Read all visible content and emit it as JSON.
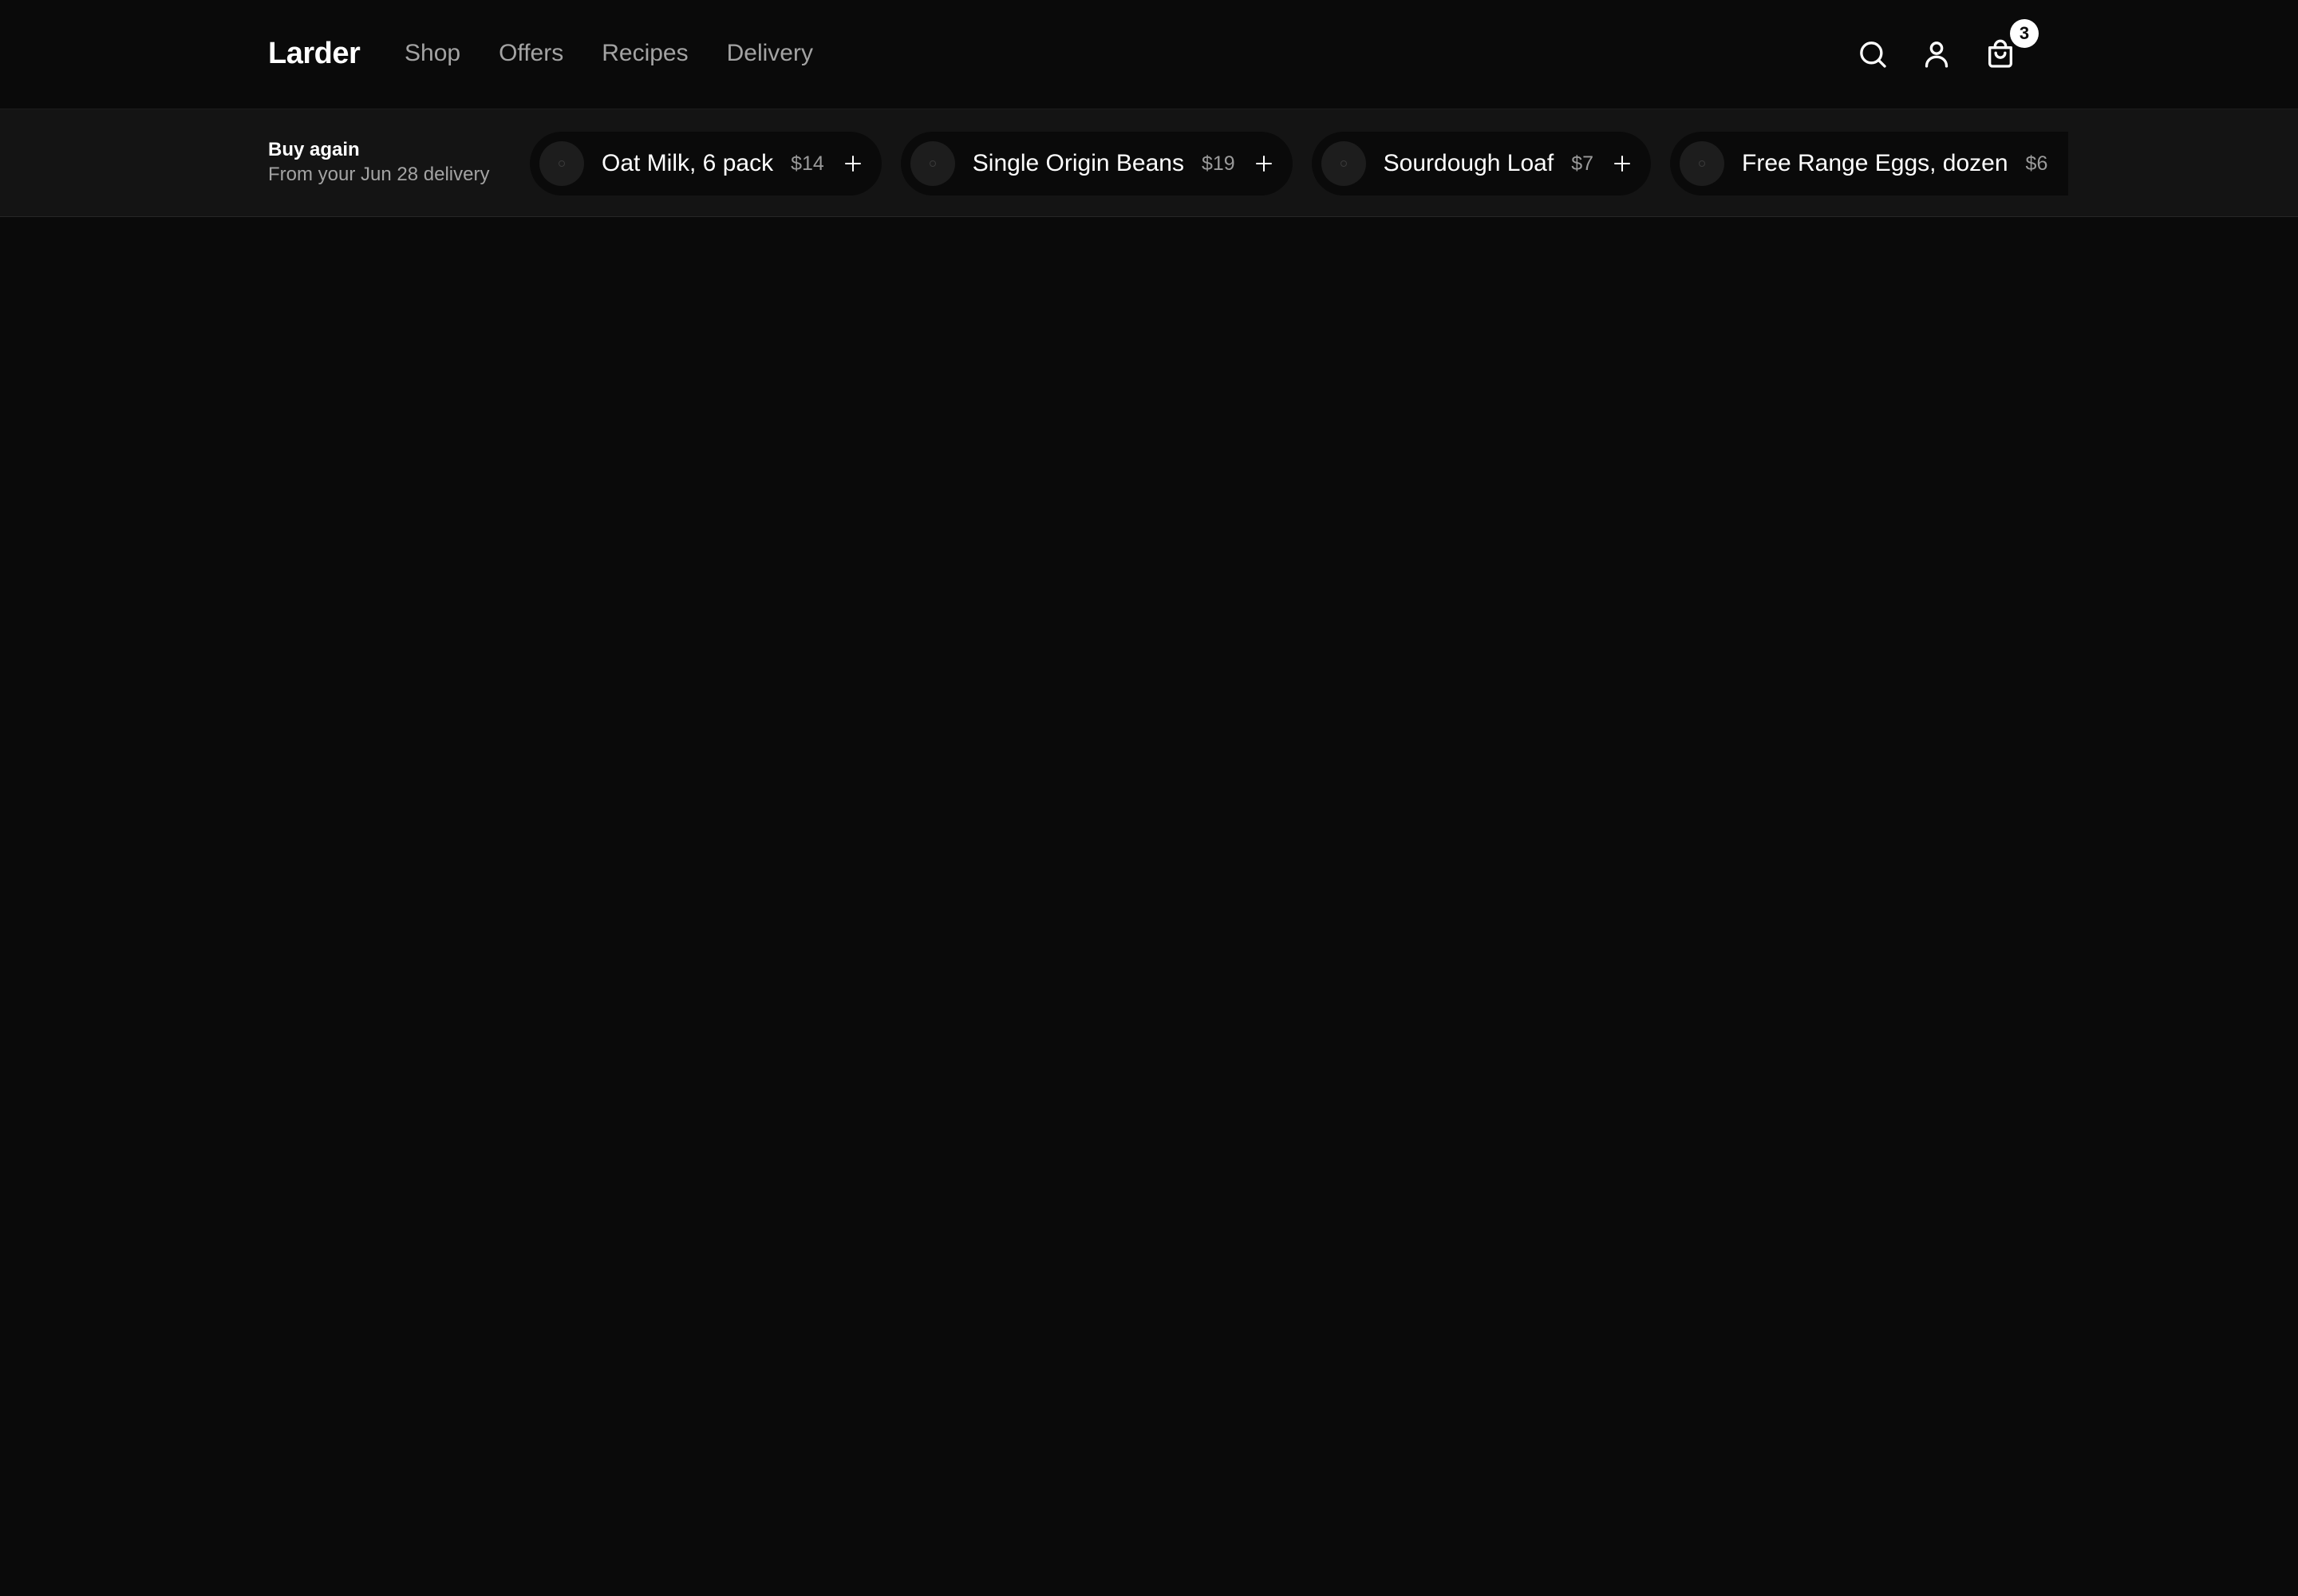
{
  "brand": {
    "name": "Larder"
  },
  "nav": {
    "items": [
      {
        "label": "Shop"
      },
      {
        "label": "Offers"
      },
      {
        "label": "Recipes"
      },
      {
        "label": "Delivery"
      }
    ]
  },
  "header_actions": {
    "search_icon": "search-icon",
    "account_icon": "user-icon",
    "cart_icon": "shopping-bag-icon",
    "cart_count": "3"
  },
  "buy_again": {
    "title": "Buy again",
    "subtitle": "From your Jun 28 delivery",
    "items": [
      {
        "name": "Oat Milk, 6 pack",
        "price": "$14"
      },
      {
        "name": "Single Origin Beans",
        "price": "$19"
      },
      {
        "name": "Sourdough Loaf",
        "price": "$7"
      },
      {
        "name": "Free Range Eggs, dozen",
        "price": "$6"
      }
    ]
  },
  "colors": {
    "background": "#0a0a0a",
    "strip": "#141414",
    "muted_text": "#a3a3a3",
    "text": "#ffffff"
  }
}
